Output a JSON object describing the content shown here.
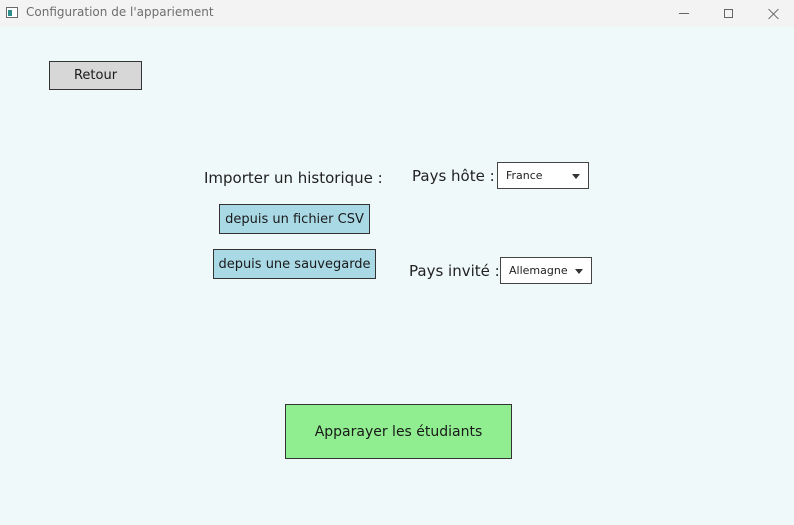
{
  "window": {
    "title": "Configuration de l'appariement",
    "icons": [
      "app-icon",
      "minimize-icon",
      "maximize-icon",
      "close-icon"
    ]
  },
  "toolbar": {
    "back_label": "Retour"
  },
  "import": {
    "label": "Importer un historique :",
    "csv_button": "depuis un fichier CSV",
    "save_button": "depuis une sauvegarde"
  },
  "host": {
    "label": "Pays hôte :",
    "selected": "France"
  },
  "guest": {
    "label": "Pays invité :",
    "selected": "Allemagne"
  },
  "actions": {
    "pair_label": "Apparayer les étudiants"
  },
  "colors": {
    "background": "#f0f9f9",
    "import_buttons": "#aad9e6",
    "pair_button": "#90ee90",
    "back_button": "#d7d7d7"
  }
}
